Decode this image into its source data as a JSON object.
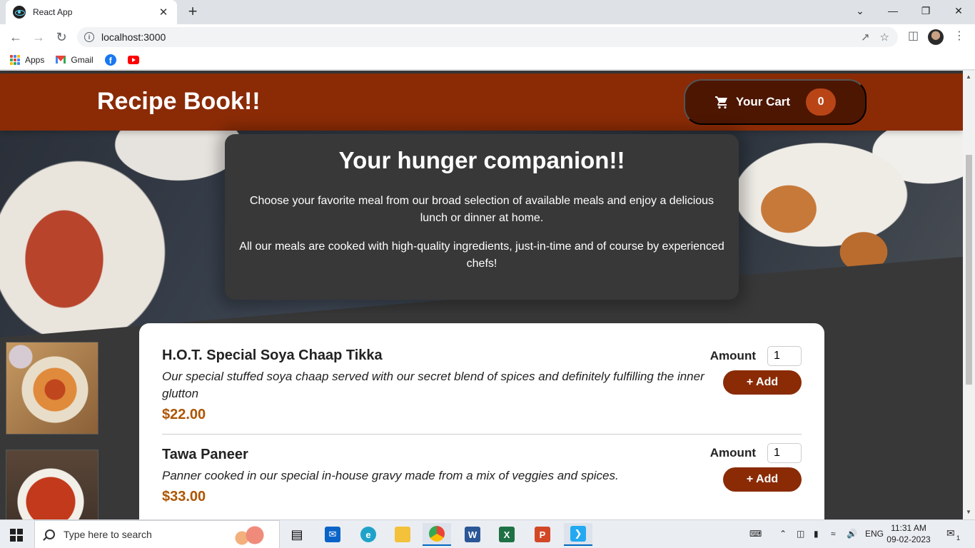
{
  "browser": {
    "tab_title": "React App",
    "tab_close": "✕",
    "new_tab": "+",
    "url": "localhost:3000",
    "window_controls": [
      "⌄",
      "—",
      "❐",
      "✕"
    ],
    "bookmarks": [
      {
        "label": "Apps",
        "icon": "apps-grid-icon"
      },
      {
        "label": "Gmail",
        "icon": "gmail-icon"
      },
      {
        "label": "",
        "icon": "facebook-icon"
      },
      {
        "label": "",
        "icon": "youtube-icon"
      }
    ]
  },
  "header": {
    "logo": "Recipe Book!!",
    "cart_label": "Your Cart",
    "cart_count": "0"
  },
  "summary": {
    "title": "Your hunger companion!!",
    "paragraph_1": "Choose your favorite meal from our broad selection of available meals and enjoy a delicious lunch or dinner at home.",
    "paragraph_2": "All our meals are cooked with high-quality ingredients, just-in-time and of course by experienced chefs!"
  },
  "meals": [
    {
      "name": "H.O.T. Special Soya Chaap Tikka",
      "description": "Our special stuffed soya chaap served with our secret blend of spices and definitely fulfilling the inner glutton",
      "price": "$22.00",
      "amount_label": "Amount",
      "amount_value": "1",
      "add_label": "+ Add"
    },
    {
      "name": "Tawa Paneer",
      "description": "Panner cooked in our special in-house gravy made from a mix of veggies and spices.",
      "price": "$33.00",
      "amount_label": "Amount",
      "amount_value": "1",
      "add_label": "+ Add"
    }
  ],
  "taskbar": {
    "search_placeholder": "Type here to search",
    "language": "ENG",
    "time": "11:31 AM",
    "date": "09-02-2023",
    "notification_count": "1"
  },
  "colors": {
    "header": "#8a2b06",
    "cart_button": "#4d1601",
    "badge": "#b94517",
    "price": "#ad5502",
    "page_background": "#383838"
  }
}
